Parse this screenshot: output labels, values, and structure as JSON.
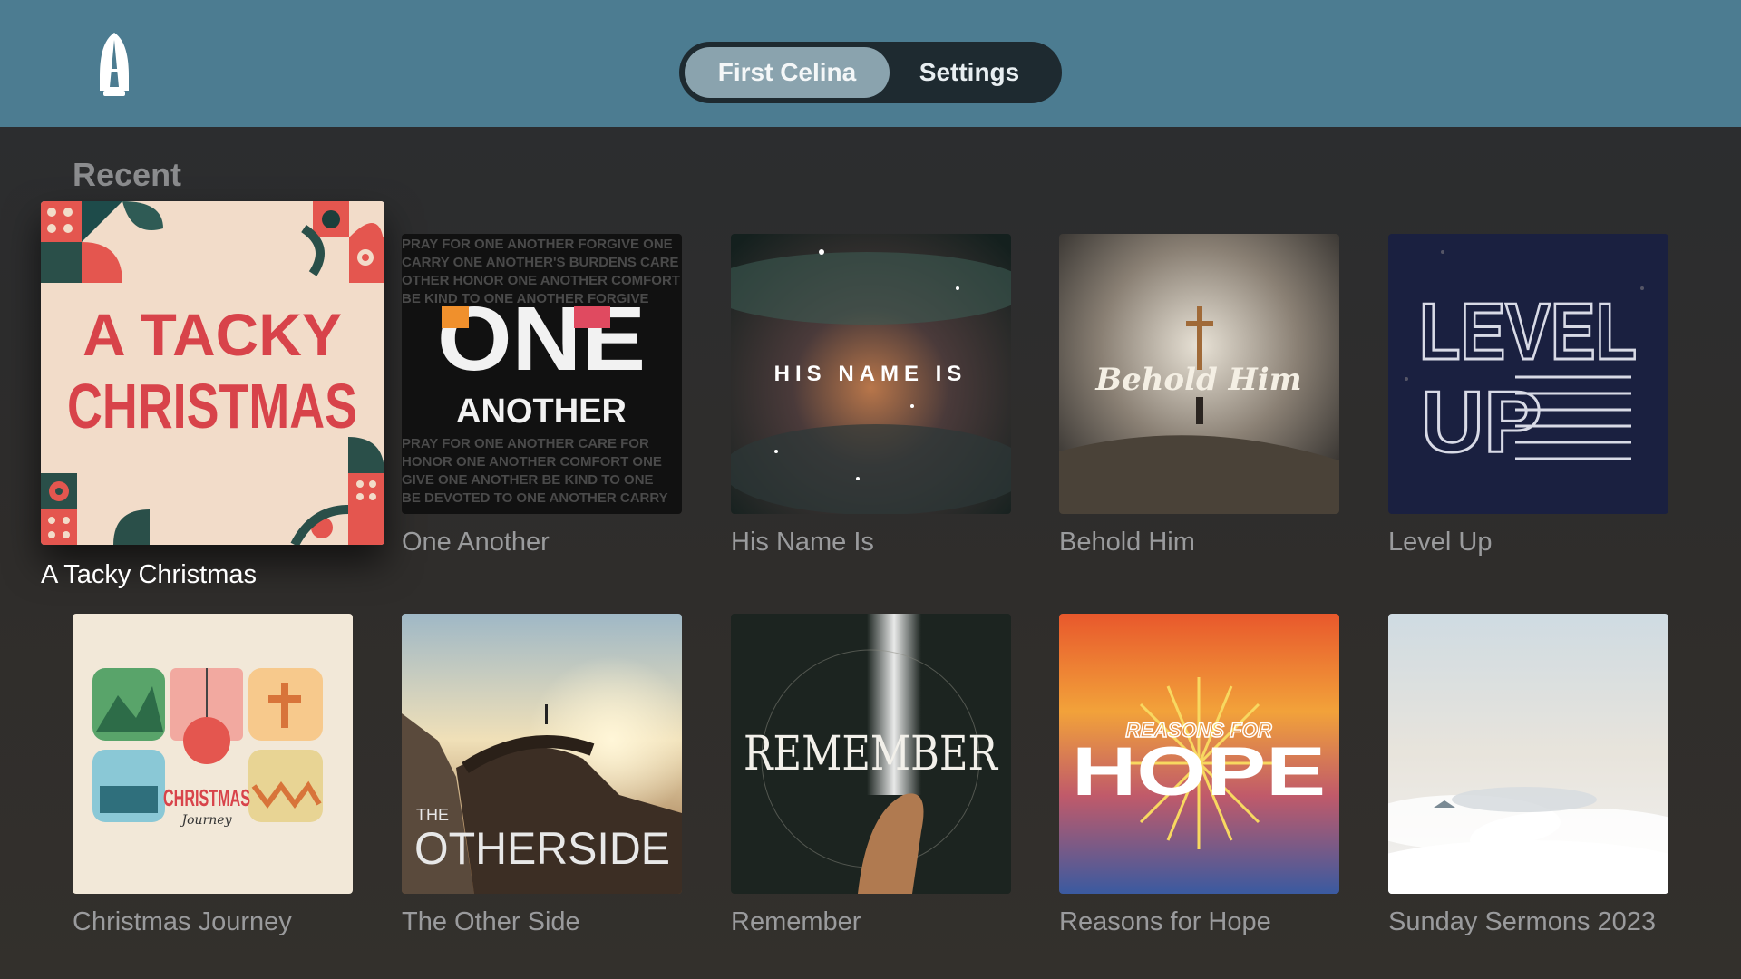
{
  "header": {
    "logo_icon": "lighthouse-logo-icon",
    "tabs": [
      {
        "label": "First Celina",
        "active": true
      },
      {
        "label": "Settings",
        "active": false
      }
    ]
  },
  "section": {
    "title": "Recent"
  },
  "items": [
    {
      "title": "A Tacky Christmas",
      "focused": true,
      "art_text": [
        "A TACKY",
        "CHRISTMAS"
      ]
    },
    {
      "title": "One Another",
      "art_text": [
        "ONE",
        "ANOTHER"
      ]
    },
    {
      "title": "His Name Is",
      "art_text": [
        "HIS NAME IS"
      ]
    },
    {
      "title": "Behold Him",
      "art_text": [
        "Behold Him"
      ]
    },
    {
      "title": "Level Up",
      "art_text": [
        "LEVEL",
        "UP"
      ]
    },
    {
      "title": "Christmas Journey",
      "art_text": [
        "CHRISTMAS",
        "Journey"
      ]
    },
    {
      "title": "The Other Side",
      "art_text": [
        "THE",
        "OTHERSIDE"
      ]
    },
    {
      "title": "Remember",
      "art_text": [
        "REMEMBER"
      ]
    },
    {
      "title": "Reasons for Hope",
      "art_text": [
        "REASONS FOR",
        "HOPE"
      ]
    },
    {
      "title": "Sunday Sermons 2023",
      "art_text": []
    }
  ],
  "colors": {
    "header": "#4c7c91",
    "accent_red": "#d8434a"
  }
}
